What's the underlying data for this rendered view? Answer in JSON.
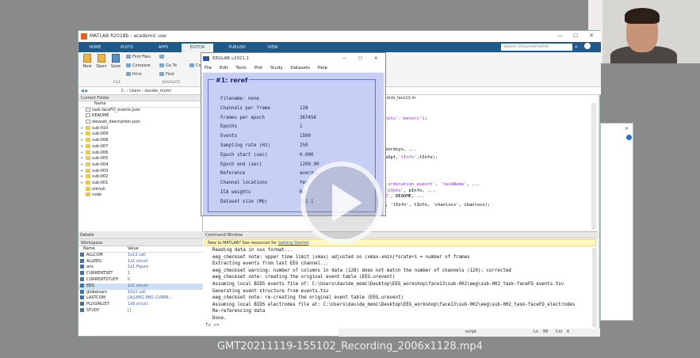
{
  "caption": "GMT20211119-155102_Recording_2006x1128.mp4",
  "matlab": {
    "title": "MATLAB R2018b - academic use",
    "tabs": [
      "HOME",
      "PLOTS",
      "APPS",
      "EDITOR",
      "PUBLISH",
      "VIEW"
    ],
    "search_placeholder": "Search Documentation",
    "ribbon": {
      "new": "New",
      "open": "Open",
      "save": "Save",
      "find_files": "Find Files",
      "compare": "Compare",
      "print": "Print",
      "go_to": "Go To",
      "find": "Find",
      "file_group": "FILE",
      "nav_group": "NAVIGATE",
      "comment": "Comm"
    },
    "address": "C: › Users › davide_momi",
    "current_folder": {
      "header": "Current Folder",
      "col_name": "Name",
      "items": [
        {
          "name": "task-faceFO_events.json",
          "type": "doc",
          "plus": ""
        },
        {
          "name": "README",
          "type": "doc",
          "plus": ""
        },
        {
          "name": "dataset_description.json",
          "type": "doc",
          "plus": ""
        },
        {
          "name": "sub-010",
          "type": "folder",
          "plus": "+"
        },
        {
          "name": "sub-009",
          "type": "folder",
          "plus": "+"
        },
        {
          "name": "sub-008",
          "type": "folder",
          "plus": "+"
        },
        {
          "name": "sub-007",
          "type": "folder",
          "plus": "+"
        },
        {
          "name": "sub-006",
          "type": "folder",
          "plus": "+"
        },
        {
          "name": "sub-005",
          "type": "folder",
          "plus": "+"
        },
        {
          "name": "sub-004",
          "type": "folder",
          "plus": "+"
        },
        {
          "name": "sub-003",
          "type": "folder",
          "plus": "+"
        },
        {
          "name": "sub-002",
          "type": "folder",
          "plus": "+"
        },
        {
          "name": "sub-001",
          "type": "folder",
          "plus": "+"
        },
        {
          "name": "stimuli",
          "type": "folder",
          "plus": ""
        },
        {
          "name": "code",
          "type": "folder",
          "plus": ""
        }
      ]
    },
    "details": "Details",
    "workspace": {
      "header": "Workspace",
      "col_name": "Name",
      "col_value": "Value",
      "items": [
        {
          "name": "ALLCOM",
          "value": "1x12 cell"
        },
        {
          "name": "ALLEEG",
          "value": "1x1 struct"
        },
        {
          "name": "ans",
          "value": "1x1 Figure"
        },
        {
          "name": "CURRENTSET",
          "value": "1"
        },
        {
          "name": "CURRENTSTUDY",
          "value": "0"
        },
        {
          "name": "EEG",
          "value": "1x1 struct"
        },
        {
          "name": "globalvars",
          "value": "10x1 cell"
        },
        {
          "name": "LASTCOM",
          "value": "[ALLEEG EEG CURRE..."
        },
        {
          "name": "PLUGINLIST",
          "value": "1x6 struct"
        },
        {
          "name": "STUDY",
          "value": "[]"
        }
      ]
    },
    "editor": {
      "filename": "bids_face13.m",
      "lines": [
        {
          "pre": "",
          "str": "'nameUnits':'meters'",
          "post": ");"
        },
        {
          "pre": "...",
          "str": "",
          "post": ""
        },
        {
          "pre": "..., eoordsys, ...",
          "str": "",
          "post": ""
        },
        {
          "pre": "), bidsOpt,",
          "str": "'tInfo'",
          "post": ",tInfo);"
        },
        {
          "pre": "",
          "str": "",
          "post": ""
        },
        {
          "pre": "... ",
          "str": "'s_ordination_export', 'taskName'",
          "post": ", ..."
        },
        {
          "pre": "info, ",
          "str": "'pInfo'",
          "post": ", pInfo, ..."
        },
        {
          "pre": "",
          "str": "'README'",
          "post": ", README, ..."
        },
        {
          "pre": "",
          "str": "",
          "post": ", code, 'tInfo', tInfo, 'chanlocs', chanlocs);"
        }
      ]
    },
    "command_window": {
      "header": "Command Window",
      "hint_prefix": "New to MATLAB? See resources for ",
      "hint_link": "Getting Started",
      "hint_suffix": ".",
      "lines": [
        "Reading data in xxx format...",
        "eeg_checkset note: upper time limit (xmax) adjusted so (xmax-xmin)*srate+1 = number of frames",
        "Extracting events from last EEG channel...",
        "eeg_checkset warning: number of columns in data (128) does not match the number of channels (129): corrected",
        "eeg_checkset note: creating the original event table (EEG.urevent)",
        "Assuming local BIDS events file of: C:\\Users\\davide_momi\\Desktop\\EEG_workshop\\face13\\sub-002\\eeg\\sub-002_task-faceFO_events.tsv",
        "Generating event structure from events.tsv",
        "eeg_checkset note: re-creating the original event table (EEG.urevent)",
        "Assuming local BIDS electrodes file at: C:\\Users\\davide_momi\\Desktop\\EEG_workshop\\face13\\sub-002\\eeg\\sub-002_task-faceFO_electrodes",
        "Re-referencing data",
        "Done."
      ],
      "prompt": "fx >>"
    },
    "status": {
      "mode": "script",
      "ln_label": "Ln",
      "ln": "89",
      "col_label": "Col",
      "col": "6"
    }
  },
  "eeglab": {
    "title": "EEGLAB v2021.1",
    "menu": [
      "File",
      "Edit",
      "Tools",
      "Plot",
      "Study",
      "Datasets",
      "Help"
    ],
    "dataset_header": "#1: reref",
    "rows": [
      {
        "label": "Filename: none",
        "value": ""
      },
      {
        "label": "Channels per frame",
        "value": "128"
      },
      {
        "label": "Frames per epoch",
        "value": "367456"
      },
      {
        "label": "Epochs",
        "value": "1"
      },
      {
        "label": "Events",
        "value": "1599"
      },
      {
        "label": "Sampling rate (Hz)",
        "value": "250"
      },
      {
        "label": "Epoch start (sec)",
        "value": "0.000"
      },
      {
        "label": "Epoch end (sec)",
        "value": "1209.90"
      },
      {
        "label": "Reference",
        "value": "average"
      },
      {
        "label": "Channel locations",
        "value": "Yes"
      },
      {
        "label": "ICA weights",
        "value": "No"
      },
      {
        "label": "Dataset size (Mb)",
        "value": "191.1"
      }
    ]
  },
  "colors": {
    "matlab_tab_bar": "#1e5a8a",
    "eeglab_bg": "#c7cff5",
    "eeglab_text": "#1a2277"
  }
}
